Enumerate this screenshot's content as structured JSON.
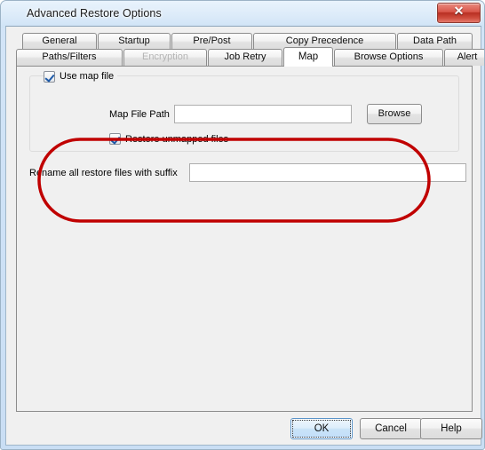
{
  "window": {
    "title": "Advanced Restore Options",
    "close_glyph": "✕",
    "close_label": "Close"
  },
  "tabs": {
    "row_top": [
      {
        "label": "General",
        "state": "normal"
      },
      {
        "label": "Startup",
        "state": "normal"
      },
      {
        "label": "Pre/Post",
        "state": "normal"
      },
      {
        "label": "Copy Precedence",
        "state": "normal"
      },
      {
        "label": "Data Path",
        "state": "normal"
      }
    ],
    "row_bottom": [
      {
        "label": "Paths/Filters",
        "state": "normal"
      },
      {
        "label": "Encryption",
        "state": "disabled"
      },
      {
        "label": "Job Retry",
        "state": "normal"
      },
      {
        "label": "Map",
        "state": "selected"
      },
      {
        "label": "Browse Options",
        "state": "normal"
      },
      {
        "label": "Alert",
        "state": "normal"
      }
    ]
  },
  "map_page": {
    "use_map_file": {
      "label": "Use map file",
      "checked": true
    },
    "map_file_path": {
      "label": "Map File Path",
      "value": "",
      "placeholder": ""
    },
    "browse_label": "Browse",
    "restore_unmapped": {
      "label": "Restore unmapped files",
      "checked": true
    },
    "rename_suffix": {
      "label": "Rename all restore files with suffix",
      "value": "",
      "placeholder": ""
    }
  },
  "annotation": {
    "shape": "ellipse-highlight",
    "color": "#c00000"
  },
  "buttons": {
    "ok": "OK",
    "cancel": "Cancel",
    "help": "Help"
  }
}
